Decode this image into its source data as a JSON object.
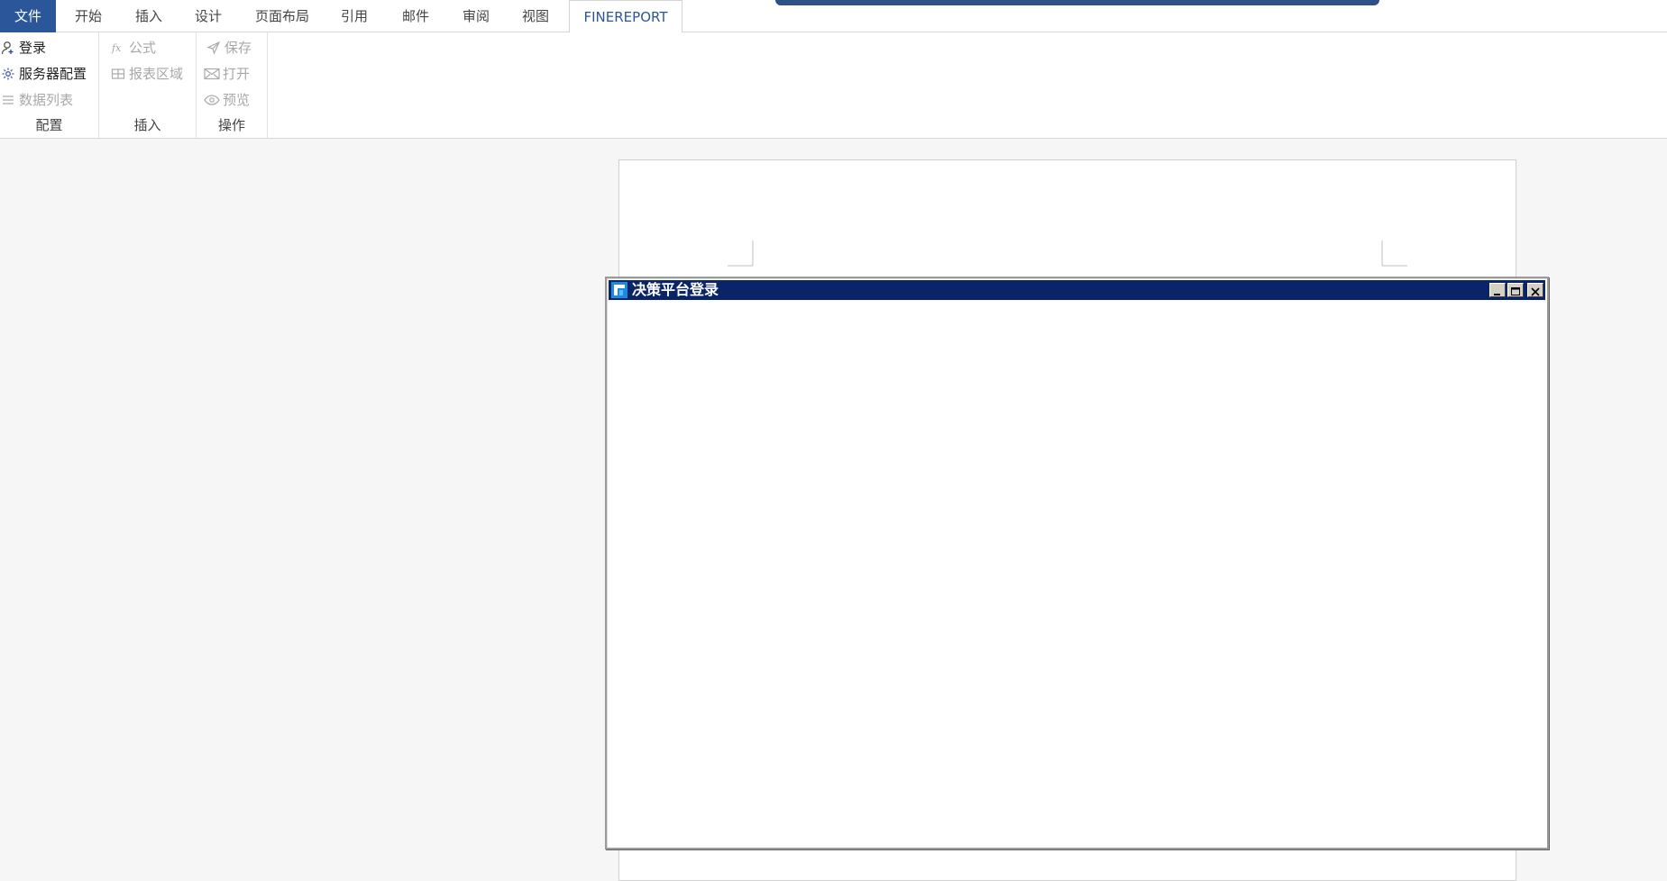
{
  "ribbon": {
    "tabs": [
      {
        "label": "文件"
      },
      {
        "label": "开始"
      },
      {
        "label": "插入"
      },
      {
        "label": "设计"
      },
      {
        "label": "页面布局"
      },
      {
        "label": "引用"
      },
      {
        "label": "邮件"
      },
      {
        "label": "审阅"
      },
      {
        "label": "视图"
      },
      {
        "label": "FINEREPORT"
      }
    ],
    "groups": [
      {
        "label": "配置",
        "commands": [
          {
            "label": "登录",
            "icon": "user-login-icon",
            "enabled": true
          },
          {
            "label": "服务器配置",
            "icon": "server-gear-icon",
            "enabled": true
          },
          {
            "label": "数据列表",
            "icon": "list-icon",
            "enabled": false
          }
        ]
      },
      {
        "label": "插入",
        "commands": [
          {
            "label": "公式",
            "icon": "fx-icon",
            "enabled": false
          },
          {
            "label": "报表区域",
            "icon": "table-icon",
            "enabled": false
          }
        ]
      },
      {
        "label": "操作",
        "commands": [
          {
            "label": "保存",
            "icon": "send-icon",
            "enabled": false
          },
          {
            "label": "打开",
            "icon": "envelope-icon",
            "enabled": false
          },
          {
            "label": "预览",
            "icon": "eye-icon",
            "enabled": false
          }
        ]
      }
    ]
  },
  "dialog": {
    "title": "决策平台登录",
    "title_bg": "#0a2468"
  },
  "colors": {
    "accent": "#2b579a",
    "workspace": "#f6f6f6"
  }
}
